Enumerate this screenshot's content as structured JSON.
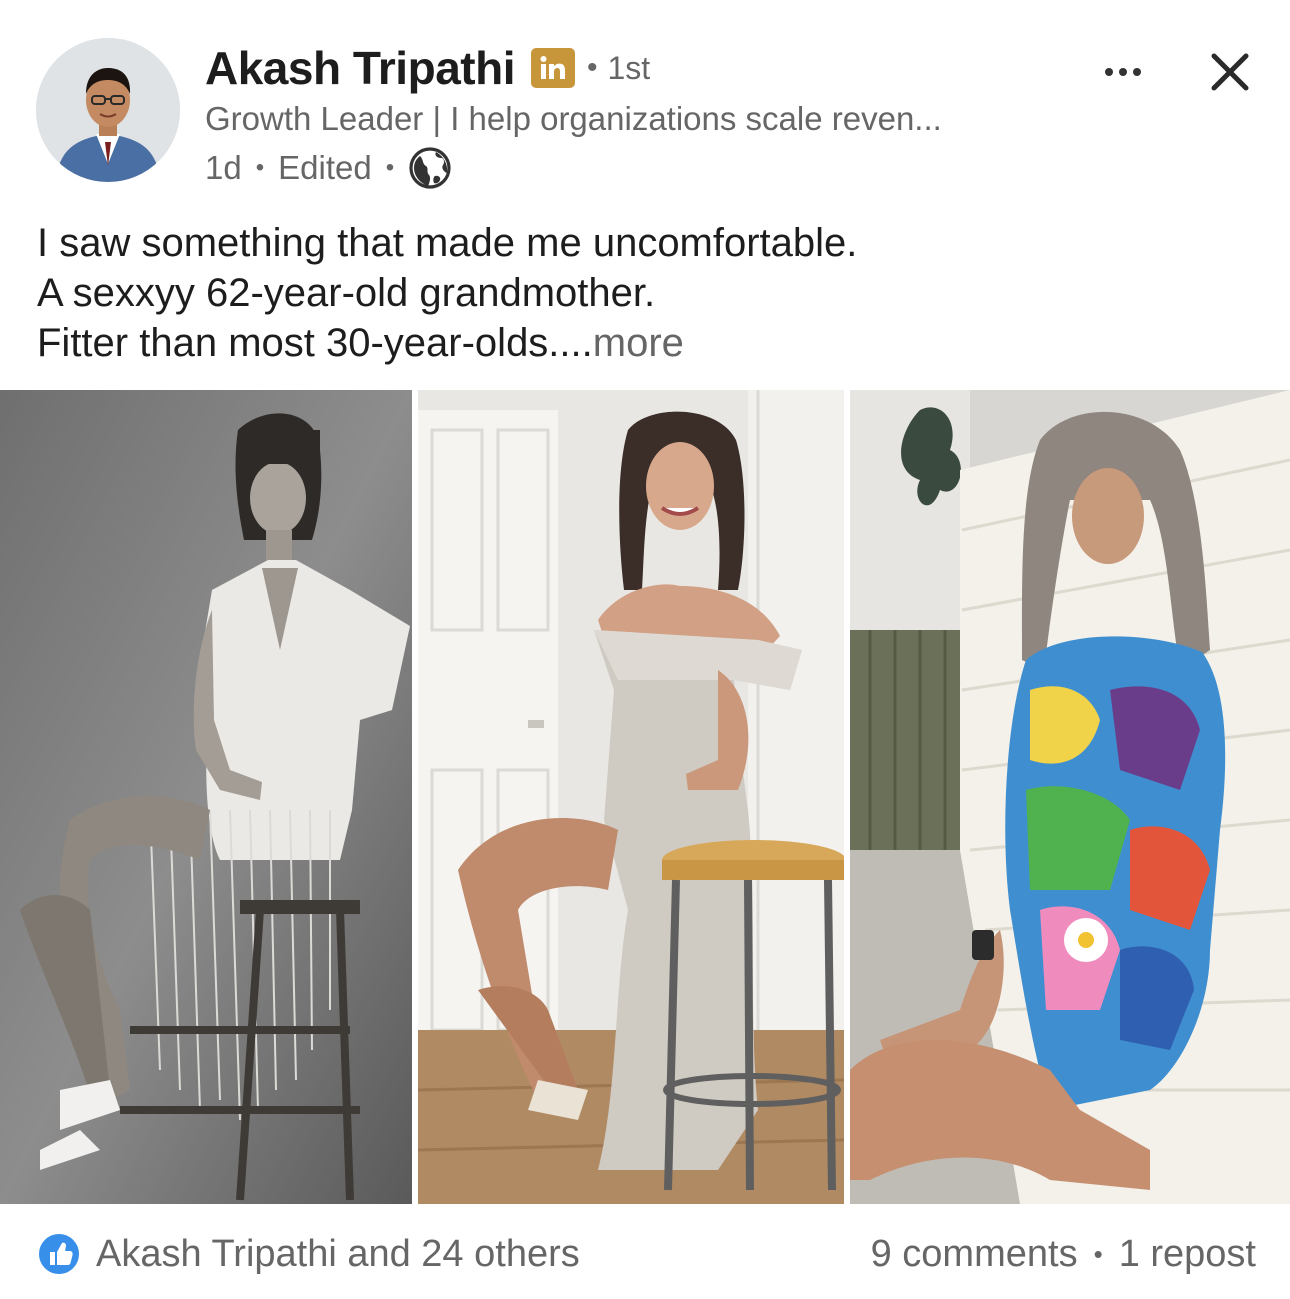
{
  "author": {
    "name": "Akash Tripathi",
    "badge_icon": "linkedin-premium-icon",
    "degree": "1st",
    "headline": "Growth Leader | I help organizations scale reven...",
    "time": "1d",
    "edited": "Edited",
    "visibility_icon": "globe-icon"
  },
  "actions": {
    "more_icon": "ellipsis-icon",
    "close_icon": "close-icon"
  },
  "post": {
    "lines": [
      "I saw something that made me uncomfortable.",
      "A sexxyy 62-year-old grandmother.",
      "Fitter than most 30-year-olds...."
    ],
    "see_more": "more"
  },
  "images": {
    "count": 3,
    "photos": [
      {
        "description_icon": "photo-black-and-white-seated-woman"
      },
      {
        "description_icon": "photo-woman-sequin-dress-stool"
      },
      {
        "description_icon": "photo-woman-colorful-dress-wall"
      }
    ]
  },
  "social": {
    "reactions_text": "Akash Tripathi and 24 others",
    "comments": "9 comments",
    "reposts": "1 repost"
  },
  "colors": {
    "badge_gold": "#c7963a",
    "like_blue": "#378fe9",
    "secondary_text": "#666666",
    "primary_text": "#1d1d1d"
  }
}
